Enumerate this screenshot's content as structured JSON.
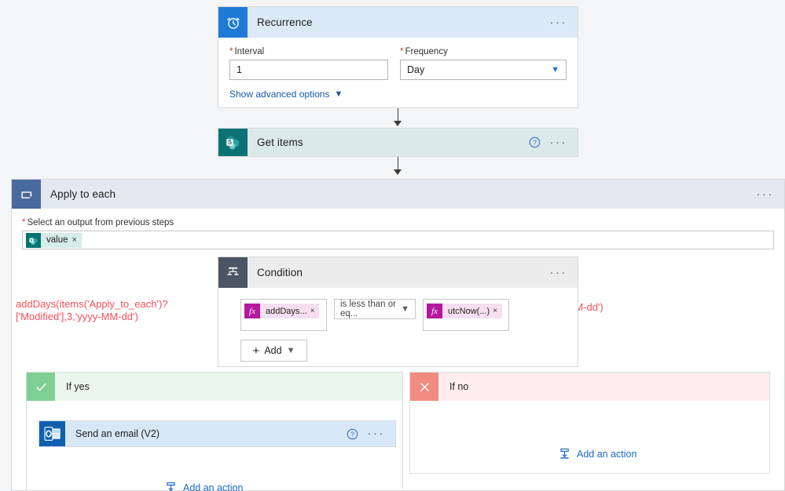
{
  "recurrence": {
    "title": "Recurrence",
    "icon": "alarm-clock-icon",
    "interval_label": "Interval",
    "interval_value": "1",
    "frequency_label": "Frequency",
    "frequency_value": "Day",
    "advanced_link": "Show advanced options",
    "menu": "···",
    "accent": "#1e7ad6",
    "header_bg": "#dceaf7"
  },
  "get_items": {
    "title": "Get items",
    "icon": "sharepoint-icon",
    "menu": "···",
    "accent": "#0b7273",
    "header_bg": "#dbe9e9"
  },
  "apply_to_each": {
    "title": "Apply to each",
    "icon": "loop-icon",
    "menu": "···",
    "select_label": "Select an output from previous steps",
    "token_label": "value",
    "token_remove": "×",
    "accent": "#486a9e",
    "header_bg": "#e4e9f1"
  },
  "condition": {
    "title": "Condition",
    "icon": "condition-branch-icon",
    "menu": "···",
    "left_operand": "addDays...",
    "left_remove": "×",
    "operator": "is less than or eq...",
    "right_operand": "utcNow(...)",
    "right_remove": "×",
    "add_label": "Add",
    "add_plus": "+",
    "fx_label": "fx",
    "accent": "#4c5564",
    "header_bg": "#ececec"
  },
  "annotations": {
    "left_expression": "addDays(items('Apply_to_each')?['Modified'],3,'yyyy-MM-dd')",
    "right_expression": "utcNow('yyyy-MM-dd')",
    "color": "#fb4e56"
  },
  "if_yes": {
    "title": "If yes",
    "icon": "checkmark-icon",
    "glyph": "✓",
    "action_title": "Send an email (V2)",
    "action_icon": "outlook-icon",
    "action_menu": "···",
    "add_action_label": "Add an action",
    "accent": "#7fce95",
    "header_bg": "#eaf6ed"
  },
  "if_no": {
    "title": "If no",
    "icon": "cross-icon",
    "glyph": "✕",
    "add_action_label": "Add an action",
    "accent": "#f28b82",
    "header_bg": "#fdeeec"
  }
}
